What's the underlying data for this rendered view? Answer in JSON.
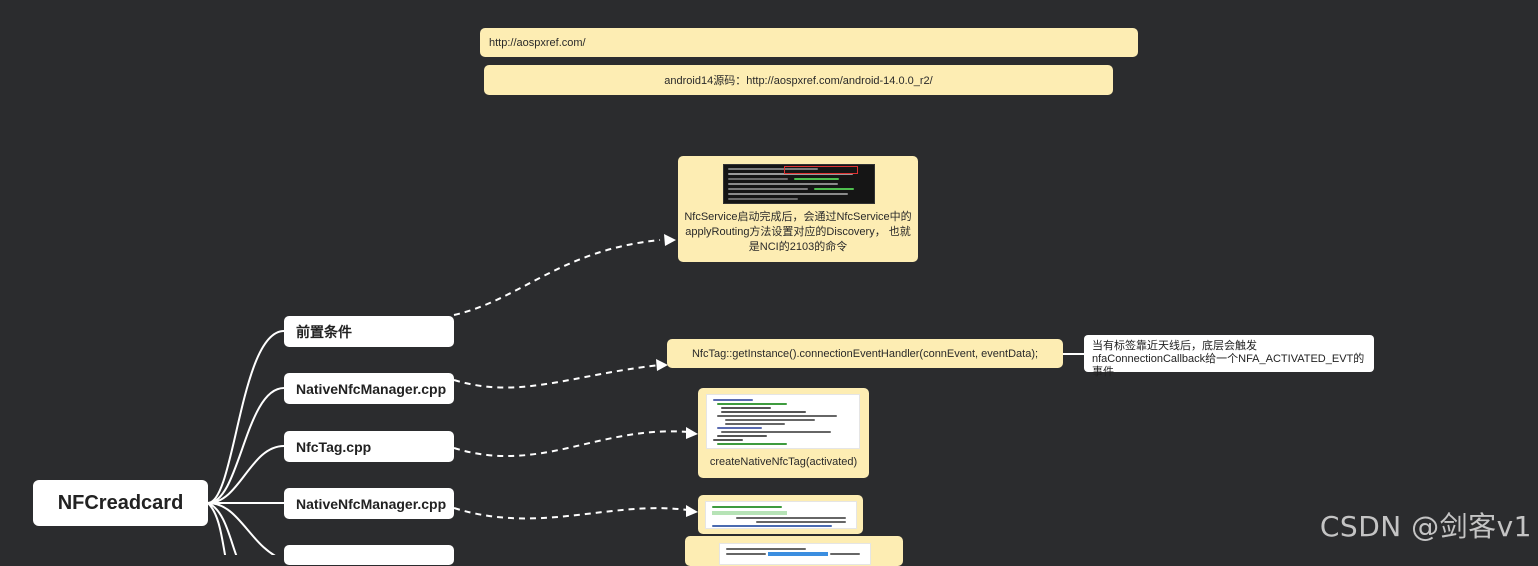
{
  "links": {
    "url": "http://aospxref.com/",
    "source_label": "android14源码：http://aospxref.com/android-14.0.0_r2/"
  },
  "root": {
    "label": "NFCreadcard"
  },
  "branches": [
    {
      "label": "前置条件"
    },
    {
      "label": "NativeNfcManager.cpp"
    },
    {
      "label": "NfcTag.cpp"
    },
    {
      "label": "NativeNfcManager.cpp"
    }
  ],
  "notes": {
    "nfcservice": "NfcService启动完成后，会通过NfcService中的applyRouting方法设置对应的Discovery， 也就是NCI的2103的命令",
    "connection_handler": "NfcTag::getInstance().connectionEventHandler(connEvent, eventData);",
    "connection_comment": "当有标签靠近天线后，底层会触发nfaConnectionCallback给一个NFA_ACTIVATED_EVT的事件",
    "create_tag": "createNativeNfcTag(activated)"
  },
  "watermark": "CSDN @剑客v1",
  "colors": {
    "background": "#2b2c2e",
    "note_fill": "#fdedb3",
    "node_fill": "#ffffff",
    "connector": "#ffffff"
  }
}
